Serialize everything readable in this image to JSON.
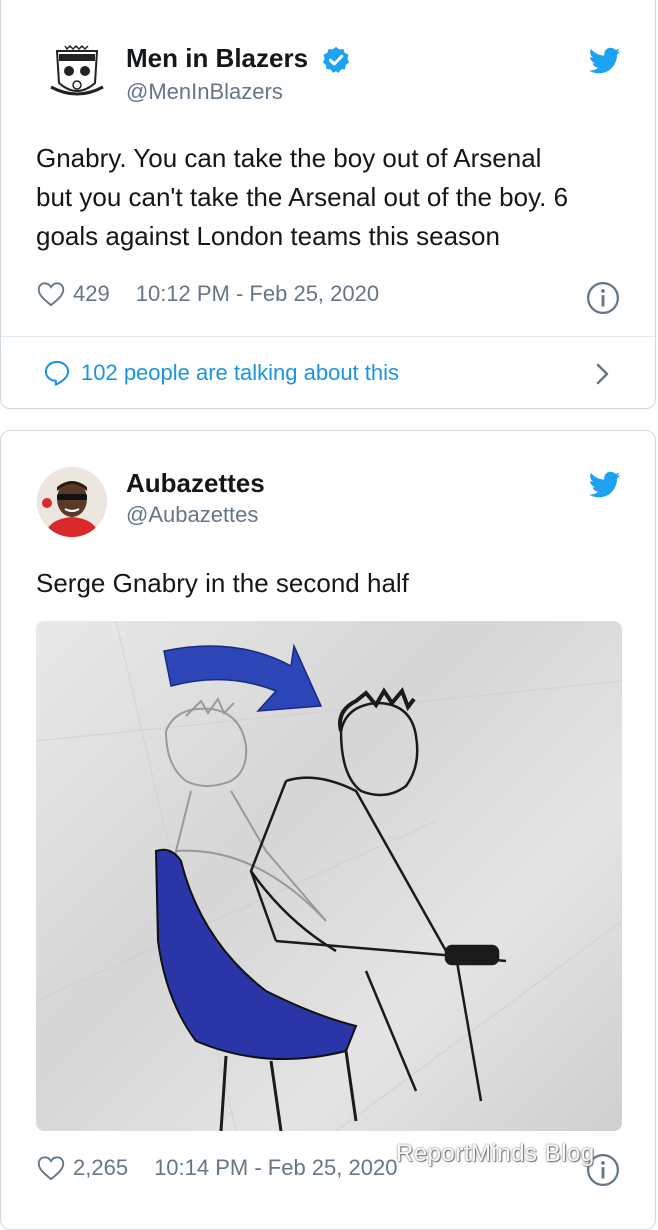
{
  "tweets": [
    {
      "name": "Men in Blazers",
      "handle": "@MenInBlazers",
      "verified": true,
      "text_lines": [
        "Gnabry. You can take the boy out of Arsenal",
        "but you can't take the Arsenal out of the boy. 6",
        "goals against London teams this season"
      ],
      "likes": "429",
      "timestamp": "10:12 PM - Feb 25, 2020",
      "talking": "102 people are talking about this",
      "avatar_icon": "men-in-blazers-crest-icon"
    },
    {
      "name": "Aubazettes",
      "handle": "@Aubazettes",
      "text": "Serge Gnabry in the second half",
      "likes": "2,265",
      "timestamp": "10:14 PM - Feb 25, 2020",
      "avatar_icon": "person-with-sunglasses-avatar"
    }
  ],
  "watermark": "ReportMinds Blog",
  "colors": {
    "twitter_blue": "#1da1f2",
    "link_blue": "#1b95e0",
    "muted": "#657786",
    "chair_blue": "#2a35a8"
  }
}
